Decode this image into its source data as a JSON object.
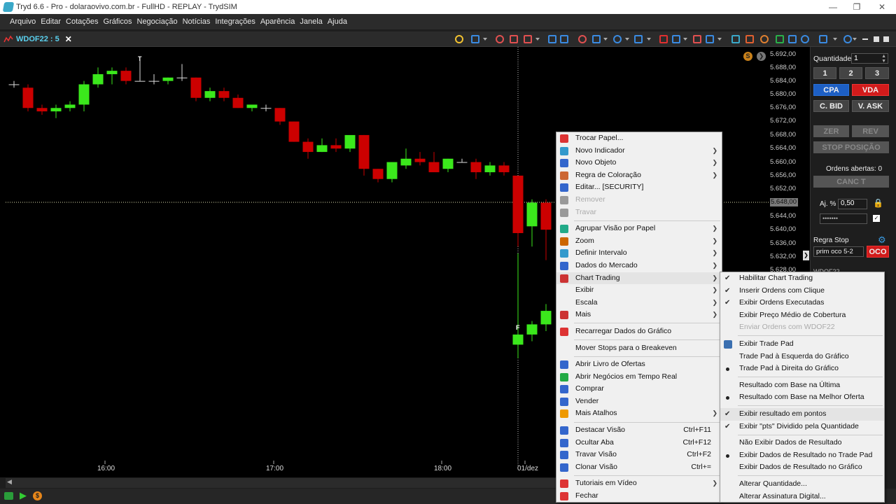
{
  "window": {
    "title": "Tryd 6.6 - Pro - dolaraovivo.com.br - FullHD - REPLAY - TrydSIM"
  },
  "menubar": {
    "items": [
      "Arquivo",
      "Editar",
      "Cotações",
      "Gráficos",
      "Negociação",
      "Notícias",
      "Integrações",
      "Aparência",
      "Janela",
      "Ajuda"
    ]
  },
  "chart_tab": {
    "label": "WDOF22 : 5"
  },
  "chart": {
    "y_ticks": [
      "5.692,00",
      "5.688,00",
      "5.684,00",
      "5.680,00",
      "5.676,00",
      "5.672,00",
      "5.668,00",
      "5.664,00",
      "5.660,00",
      "5.656,00",
      "5.652,00",
      "5.644,00",
      "5.640,00",
      "5.636,00",
      "5.632,00",
      "5.628,00"
    ],
    "price_marker": "5.648,00",
    "x_ticks": [
      "16:00",
      "17:00",
      "18:00",
      "01/dez"
    ],
    "marker_T": "T",
    "marker_F": "F",
    "badge": "S"
  },
  "panel": {
    "qty_label": "Quantidade",
    "qty_value": "1",
    "qty_presets": [
      "1",
      "2",
      "3"
    ],
    "buy": "CPA",
    "sell": "VDA",
    "bid": "C. BID",
    "ask": "V. ASK",
    "zero": "ZER",
    "rev": "REV",
    "stop_pos": "STOP POSIÇÃO",
    "open_orders": "Ordens abertas: 0",
    "cancel": "CANC T",
    "adj_label": "Aj. %",
    "adj_value": "0,50",
    "password_mask": "•••••••",
    "stop_rule_label": "Regra Stop",
    "stop_rule_value": "prim oco 5-2",
    "oco": "OCO",
    "row_label": "WDOF22"
  },
  "context_menu": {
    "items": [
      {
        "label": "Trocar Papel...",
        "sub": false
      },
      {
        "label": "Novo Indicador",
        "sub": true
      },
      {
        "label": "Novo Objeto",
        "sub": true
      },
      {
        "label": "Regra de Coloração",
        "sub": true
      },
      {
        "label": "Editar... [SECURITY]",
        "sub": false
      },
      {
        "label": "Remover",
        "sub": false,
        "disabled": true
      },
      {
        "label": "Travar",
        "sub": false,
        "disabled": true
      },
      {
        "sep": true
      },
      {
        "label": "Agrupar Visão por Papel",
        "sub": true
      },
      {
        "label": "Zoom",
        "sub": true
      },
      {
        "label": "Definir Intervalo",
        "sub": true
      },
      {
        "label": "Dados do Mercado",
        "sub": true
      },
      {
        "label": "Chart Trading",
        "sub": true,
        "highlight": true
      },
      {
        "label": "Exibir",
        "sub": true
      },
      {
        "label": "Escala",
        "sub": true
      },
      {
        "label": "Mais",
        "sub": true
      },
      {
        "sep": true
      },
      {
        "label": "Recarregar Dados do Gráfico",
        "sub": false
      },
      {
        "sep": true
      },
      {
        "label": "Mover Stops para o Breakeven",
        "sub": false
      },
      {
        "sep": true
      },
      {
        "label": "Abrir Livro de Ofertas",
        "sub": false
      },
      {
        "label": "Abrir Negócios em Tempo Real",
        "sub": false
      },
      {
        "label": "Comprar",
        "sub": false
      },
      {
        "label": "Vender",
        "sub": false
      },
      {
        "label": "Mais Atalhos",
        "sub": true
      },
      {
        "sep": true
      },
      {
        "label": "Destacar Visão",
        "shortcut": "Ctrl+F11"
      },
      {
        "label": "Ocultar Aba",
        "shortcut": "Ctrl+F12"
      },
      {
        "label": "Travar Visão",
        "shortcut": "Ctrl+F2"
      },
      {
        "label": "Clonar Visão",
        "shortcut": "Ctrl+="
      },
      {
        "sep": true
      },
      {
        "label": "Tutoriais em Vídeo",
        "sub": true
      },
      {
        "label": "Fechar",
        "sub": false
      }
    ],
    "icon_colors": [
      "#d33",
      "#39c",
      "#36c",
      "#c63",
      "#36c",
      "#999",
      "#999",
      null,
      "#2a8",
      "#c60",
      "#39c",
      "#36c",
      "#c33",
      "",
      "",
      "#c33",
      null,
      "#d33",
      null,
      "",
      null,
      "#36c",
      "#2a4",
      "#36c",
      "#36c",
      "#e90",
      null,
      "#36c",
      "#36c",
      "#36c",
      "#36c",
      null,
      "#d33",
      "#d33"
    ]
  },
  "submenu": {
    "items": [
      {
        "label": "Habilitar Chart Trading",
        "mark": "check"
      },
      {
        "label": "Inserir Ordens com Clique",
        "mark": "check"
      },
      {
        "label": "Exibir Ordens Executadas",
        "mark": "check"
      },
      {
        "label": "Exibir Preço Médio de Cobertura",
        "mark": ""
      },
      {
        "label": "Enviar Ordens com WDOF22",
        "mark": "",
        "disabled": true
      },
      {
        "sep": true
      },
      {
        "label": "Exibir Trade Pad",
        "mark": "icon"
      },
      {
        "label": "Trade Pad à Esquerda do Gráfico",
        "mark": ""
      },
      {
        "label": "Trade Pad à Direita do Gráfico",
        "mark": "dot"
      },
      {
        "sep": true
      },
      {
        "label": "Resultado com Base na Última",
        "mark": ""
      },
      {
        "label": "Resultado com Base na Melhor Oferta",
        "mark": "dot"
      },
      {
        "sep": true
      },
      {
        "label": "Exibir resultado em pontos",
        "mark": "check",
        "highlight": true
      },
      {
        "label": "Exibir \"pts\" Dividido pela Quantidade",
        "mark": "check"
      },
      {
        "sep": true
      },
      {
        "label": "Não Exibir Dados de Resultado",
        "mark": ""
      },
      {
        "label": "Exibir Dados de Resultado no Trade Pad",
        "mark": "dot"
      },
      {
        "label": "Exibir Dados de Resultado no Gráfico",
        "mark": ""
      },
      {
        "sep": true
      },
      {
        "label": "Alterar Quantidade...",
        "mark": ""
      },
      {
        "label": "Alterar Assinatura Digital...",
        "mark": ""
      }
    ]
  },
  "candles": [
    [
      5683,
      5684,
      5682,
      5683
    ],
    [
      5682,
      5683,
      5675,
      5676
    ],
    [
      5676,
      5677,
      5674,
      5675
    ],
    [
      5675,
      5677,
      5673,
      5676
    ],
    [
      5676,
      5678,
      5675,
      5677
    ],
    [
      5677,
      5684,
      5675,
      5683
    ],
    [
      5683,
      5688,
      5682,
      5686
    ],
    [
      5686,
      5688,
      5683,
      5687
    ],
    [
      5687,
      5688,
      5683,
      5684
    ],
    [
      5684,
      5690,
      5684,
      5684
    ],
    [
      5684,
      5686,
      5683,
      5684
    ],
    [
      5684,
      5685,
      5683,
      5685
    ],
    [
      5685,
      5689,
      5684,
      5685
    ],
    [
      5685,
      5685,
      5678,
      5679
    ],
    [
      5679,
      5682,
      5678,
      5681
    ],
    [
      5681,
      5682,
      5678,
      5679
    ],
    [
      5679,
      5680,
      5676,
      5676
    ],
    [
      5676,
      5677,
      5675,
      5677
    ],
    [
      5676,
      5677,
      5675,
      5676
    ],
    [
      5676,
      5676,
      5671,
      5672
    ],
    [
      5672,
      5672,
      5666,
      5666
    ],
    [
      5666,
      5667,
      5661,
      5663
    ],
    [
      5663,
      5667,
      5663,
      5665
    ],
    [
      5665,
      5667,
      5663,
      5664
    ],
    [
      5664,
      5667,
      5663,
      5668
    ],
    [
      5668,
      5668,
      5656,
      5658
    ],
    [
      5658,
      5658,
      5654,
      5655
    ],
    [
      5655,
      5660,
      5654,
      5660
    ],
    [
      5659,
      5664,
      5658,
      5661
    ],
    [
      5661,
      5663,
      5659,
      5660
    ],
    [
      5660,
      5663,
      5657,
      5657
    ],
    [
      5658,
      5661,
      5657,
      5661
    ],
    [
      5660,
      5661,
      5660,
      5660
    ],
    [
      5660,
      5661,
      5655,
      5657
    ],
    [
      5657,
      5660,
      5656,
      5659
    ],
    [
      5659,
      5660,
      5656,
      5657
    ],
    [
      5656,
      5654,
      5635,
      5639
    ],
    [
      5641,
      5649,
      5635,
      5648
    ],
    [
      5648,
      5649,
      5631,
      5640
    ],
    [
      5606,
      5633,
      5602,
      5609
    ],
    [
      5609,
      5613,
      5607,
      5612
    ],
    [
      5612,
      5618,
      5610,
      5616
    ]
  ]
}
